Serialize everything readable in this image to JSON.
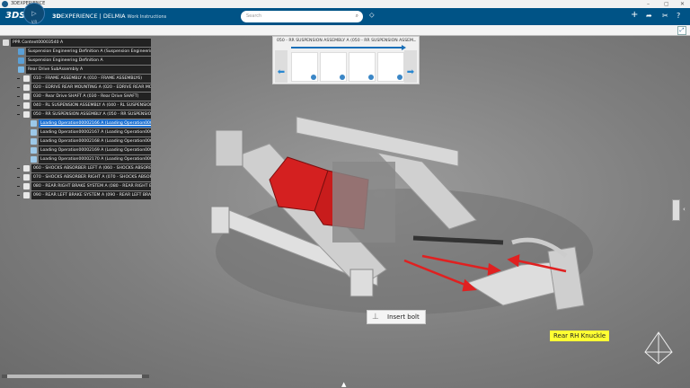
{
  "window": {
    "title": "3DEXPERIENCE",
    "controls": [
      "–",
      "▢",
      "✕"
    ]
  },
  "topbar": {
    "brand": "3D",
    "brand_rest": "EXPERIENCE | DELMIA",
    "app": "Work Instructions",
    "compass_label": "V.R",
    "search_placeholder": "Search"
  },
  "tree": {
    "items": [
      {
        "label": "PPR Context00003540 A",
        "level": 0,
        "icon": "ppr-icon"
      },
      {
        "label": "Suspension Engineering Definition A (Suspension Engineering Def",
        "level": 1,
        "icon": "engineering-icon"
      },
      {
        "label": "Suspension Engineering Definition A",
        "level": 1,
        "icon": "engineering-icon"
      },
      {
        "label": "Rear Drive SubAssembly A",
        "level": 1,
        "icon": "subassembly-icon"
      },
      {
        "label": "010 - FRAME ASSEMBLY A (010 - FRAME ASSEMBLY6)",
        "level": 2,
        "icon": "operation-icon"
      },
      {
        "label": "020 - EDRIVE REAR MOUNTING A (020 - EDRIVE REAR MOUN",
        "level": 2,
        "icon": "operation-icon"
      },
      {
        "label": "030 - Rear Drive SHAFT A (030 - Rear Drive SHAFT)",
        "level": 2,
        "icon": "operation-icon"
      },
      {
        "label": "040 - RL SUSPENSION ASSEMBLY A (040 - RL SUSPENSION A",
        "level": 2,
        "icon": "operation-icon"
      },
      {
        "label": "050 - RR SUSPENSION ASSEMBLY A (050 - RR SUSPENSION A",
        "level": 2,
        "icon": "operation-icon"
      },
      {
        "label": "Loading Operation00002166 A (Loading Operation000021",
        "level": 3,
        "icon": "loading-icon",
        "selected": true
      },
      {
        "label": "Loading Operation00002167 A (Loading Operation000021",
        "level": 3,
        "icon": "loading-icon"
      },
      {
        "label": "Loading Operation00002168 A (Loading Operation000021",
        "level": 3,
        "icon": "loading-icon"
      },
      {
        "label": "Loading Operation00002169 A (Loading Operation000021",
        "level": 3,
        "icon": "loading-icon"
      },
      {
        "label": "Loading Operation00002170 A (Loading Operation000021",
        "level": 3,
        "icon": "loading-icon"
      },
      {
        "label": "060 - SHOCKS ABSORBER LEFT A (060 - SHOCKS ABSORBER L",
        "level": 2,
        "icon": "operation-icon"
      },
      {
        "label": "070 - SHOCKS ABSORBER RIGHT A (070 - SHOCKS ABSORBE",
        "level": 2,
        "icon": "operation-icon"
      },
      {
        "label": "080 - REAR RIGHT BRAKE SYSTEM A (080 - REAR RIGHT BRAK",
        "level": 2,
        "icon": "operation-icon"
      },
      {
        "label": "090 - REAR LEFT BRAKE SYSTEM A (090 - REAR LEFT BRAKE S",
        "level": 2,
        "icon": "operation-icon"
      }
    ]
  },
  "filmstrip": {
    "title": "050 - RR SUSPENSION ASSEMBLY A (050 - RR SUSPENSION ASSEM",
    "minimize": "–",
    "thumbnails": [
      "nut",
      "bolt",
      "bolt",
      "nut"
    ]
  },
  "callouts": {
    "insert_bolt": "Insert bolt",
    "knuckle": "Rear RH Knuckle"
  },
  "colors": {
    "topbar": "#005386",
    "selection": "#1a6fd1",
    "battery": "#d42020",
    "knuckle_label": "#ffff33",
    "arrows": "#e02020"
  }
}
